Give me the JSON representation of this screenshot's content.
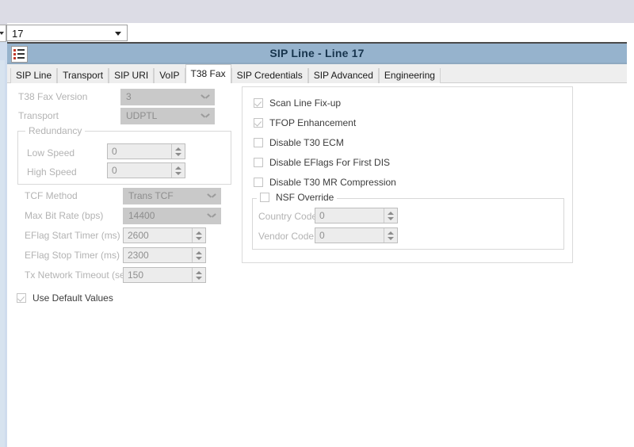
{
  "window": {
    "title": "SIP Line - Line 17",
    "icon": "list-icon"
  },
  "line_selector": {
    "value": "17",
    "icon": "chevron-down-icon"
  },
  "tabs": [
    {
      "label": "SIP Line",
      "active": false
    },
    {
      "label": "Transport",
      "active": false
    },
    {
      "label": "SIP URI",
      "active": false
    },
    {
      "label": "VoIP",
      "active": false
    },
    {
      "label": "T38 Fax",
      "active": true
    },
    {
      "label": "SIP Credentials",
      "active": false
    },
    {
      "label": "SIP Advanced",
      "active": false
    },
    {
      "label": "Engineering",
      "active": false
    }
  ],
  "left_panel": {
    "t38_fax_version": {
      "label": "T38 Fax Version",
      "value": "3"
    },
    "transport": {
      "label": "Transport",
      "value": "UDPTL"
    },
    "redundancy": {
      "title": "Redundancy",
      "low_speed": {
        "label": "Low Speed",
        "value": "0"
      },
      "high_speed": {
        "label": "High Speed",
        "value": "0"
      }
    },
    "tcf_method": {
      "label": "TCF Method",
      "value": "Trans TCF"
    },
    "max_bit_rate": {
      "label": "Max Bit Rate (bps)",
      "value": "14400"
    },
    "eflag_start_timer": {
      "label": "EFlag Start Timer (ms)",
      "value": "2600"
    },
    "eflag_stop_timer": {
      "label": "EFlag Stop Timer (ms)",
      "value": "2300"
    },
    "tx_network_timeout": {
      "label": "Tx Network Timeout (sec)",
      "value": "150"
    },
    "use_default_values": {
      "label": "Use Default Values",
      "checked": true
    }
  },
  "right_panel": {
    "checkboxes": [
      {
        "label": "Scan Line Fix-up",
        "checked": true
      },
      {
        "label": "TFOP Enhancement",
        "checked": true
      },
      {
        "label": "Disable T30 ECM",
        "checked": false
      },
      {
        "label": "Disable EFlags For First DIS",
        "checked": false
      },
      {
        "label": "Disable T30 MR Compression",
        "checked": false
      }
    ],
    "nsf_override": {
      "label": "NSF Override",
      "checked": false,
      "country_code": {
        "label": "Country Code",
        "value": "0"
      },
      "vendor_code": {
        "label": "Vendor Code",
        "value": "0"
      }
    }
  },
  "colors": {
    "titlebar": "#96b3cd",
    "title_text": "#17344d",
    "chrome": "#dcdce5",
    "tab_strip": "#eeeeee",
    "disabled_text": "#b3b3b3"
  }
}
